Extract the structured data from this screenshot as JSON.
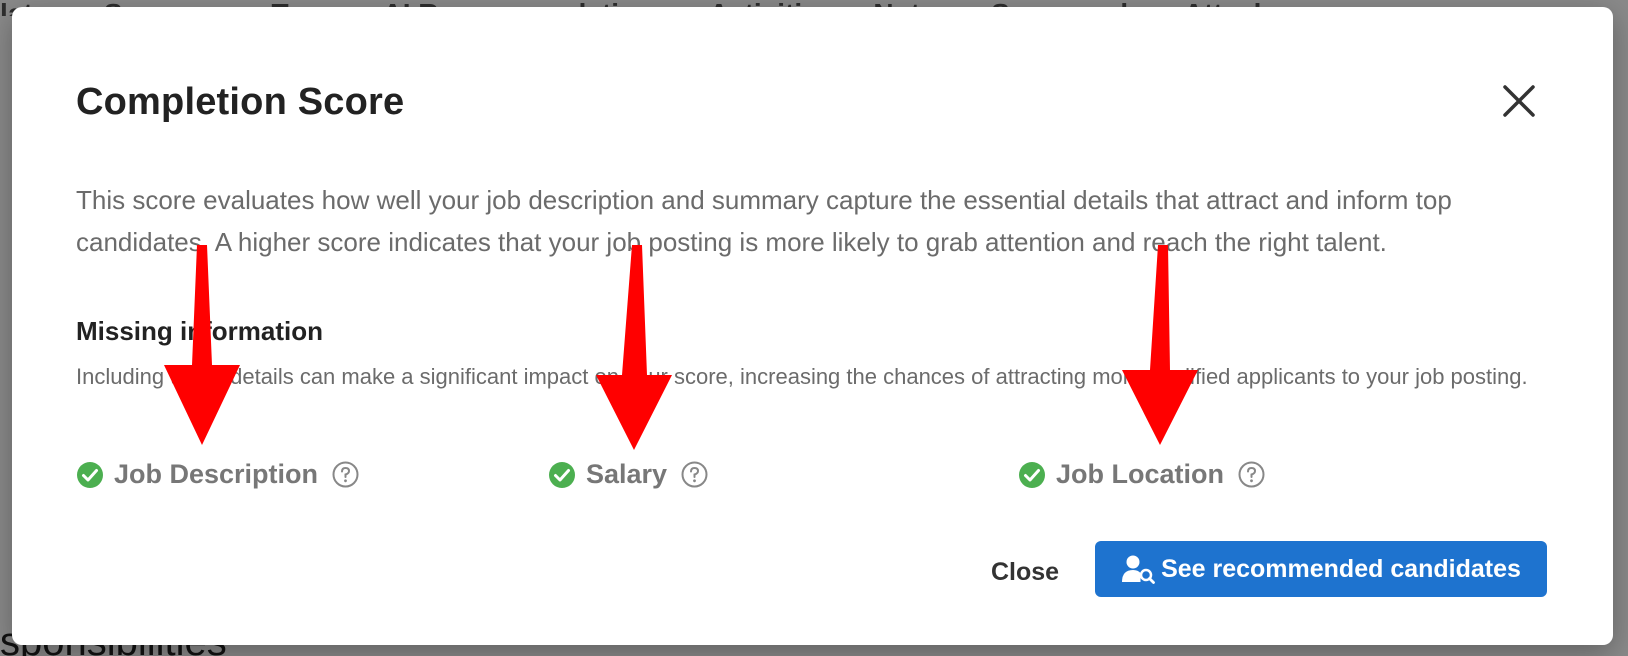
{
  "background": {
    "tabs": [
      "lates",
      "Summary",
      "Team",
      "AI Recommendations",
      "Activities",
      "Notes",
      "Scorecards",
      "Attachme"
    ],
    "bottom_text": "sponsibilities"
  },
  "modal": {
    "title": "Completion Score",
    "description": "This score evaluates how well your job description and summary capture the essential details that attract and inform top candidates. A higher score indicates that your job posting is more likely to grab attention and reach the right talent.",
    "section_title": "Missing information",
    "section_subtitle": "Including these details can make a significant impact on your score, increasing the chances of attracting more qualified applicants to your job posting.",
    "items": [
      {
        "label": "Job Description",
        "status": "complete",
        "icon": "check-circle-icon"
      },
      {
        "label": "Salary",
        "status": "complete",
        "icon": "check-circle-icon"
      },
      {
        "label": "Job Location",
        "status": "complete",
        "icon": "check-circle-icon"
      }
    ],
    "close_label": "Close",
    "primary_label": "See recommended candidates"
  },
  "colors": {
    "accent": "#1e73cf",
    "check": "#4caf50",
    "annotation_arrow": "#ff0000"
  }
}
